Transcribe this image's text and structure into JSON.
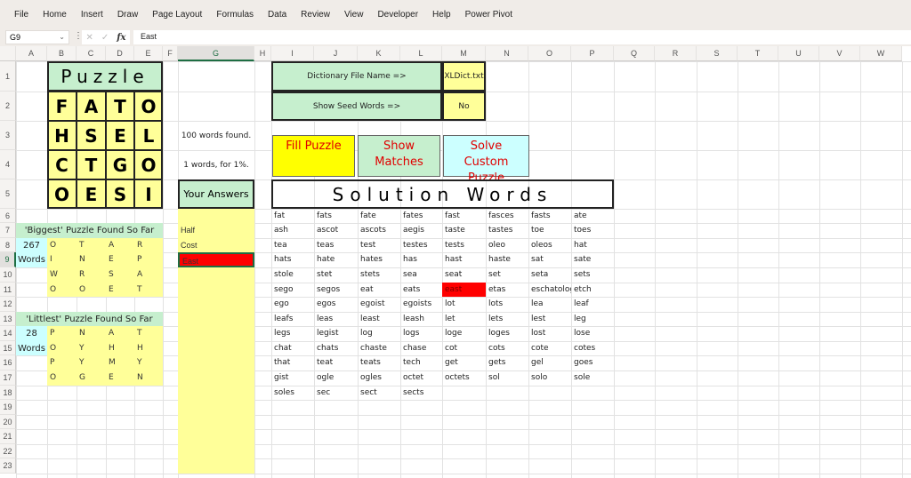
{
  "ribbon": {
    "tabs": [
      "File",
      "Home",
      "Insert",
      "Draw",
      "Page Layout",
      "Formulas",
      "Data",
      "Review",
      "View",
      "Developer",
      "Help",
      "Power Pivot"
    ]
  },
  "formula_bar": {
    "name_box": "G9",
    "cancel_icon": "✕",
    "enter_icon": "✓",
    "fx_label": "fx",
    "value": "East"
  },
  "columns": [
    "A",
    "B",
    "C",
    "D",
    "E",
    "F",
    "G",
    "H",
    "I",
    "J",
    "K",
    "L",
    "M",
    "N",
    "O",
    "P",
    "Q",
    "R",
    "S",
    "T",
    "U",
    "V",
    "W"
  ],
  "rows": [
    "1",
    "2",
    "3",
    "4",
    "5",
    "6",
    "7",
    "8",
    "9",
    "10",
    "11",
    "12",
    "13",
    "14",
    "15",
    "16",
    "17",
    "18",
    "19",
    "20",
    "21",
    "22",
    "23"
  ],
  "selected_cell": {
    "column": "G",
    "row": "9"
  },
  "puzzle": {
    "title": "Puzzle",
    "grid": [
      [
        "F",
        "A",
        "T",
        "O"
      ],
      [
        "H",
        "S",
        "E",
        "L"
      ],
      [
        "C",
        "T",
        "G",
        "O"
      ],
      [
        "O",
        "E",
        "S",
        "I"
      ]
    ]
  },
  "status": {
    "words_found": "100 words found.",
    "score": "1 words, for 1%."
  },
  "your_answers": {
    "header": "Your Answers",
    "answers": [
      "Half",
      "Cost",
      "East"
    ],
    "highlight_color": "#ff0000"
  },
  "settings": {
    "dictionary_label": "Dictionary File Name =>",
    "dictionary_value": "XLDict.txt",
    "seed_label": "Show Seed Words =>",
    "seed_value": "No"
  },
  "buttons": {
    "fill": "Fill Puzzle",
    "show": "Show Matches",
    "solve": "Solve Custom Puzzle"
  },
  "solution": {
    "title": "Solution Words",
    "highlight": "east",
    "columns": [
      [
        "fat",
        "ash",
        "tea",
        "hats",
        "stole",
        "sego",
        "ego",
        "leafs",
        "legs",
        "chat",
        "that",
        "gist",
        "soles"
      ],
      [
        "fats",
        "ascot",
        "teas",
        "hate",
        "stet",
        "segos",
        "egos",
        "leas",
        "legist",
        "chats",
        "teat",
        "ogle",
        "sec"
      ],
      [
        "fate",
        "ascots",
        "test",
        "hates",
        "stets",
        "eat",
        "egoist",
        "least",
        "log",
        "chaste",
        "teats",
        "ogles",
        "sect"
      ],
      [
        "fates",
        "aegis",
        "testes",
        "has",
        "sea",
        "eats",
        "egoists",
        "leash",
        "logs",
        "chase",
        "tech",
        "octet",
        "sects"
      ],
      [
        "fast",
        "taste",
        "tests",
        "hast",
        "seat",
        "east",
        "lot",
        "let",
        "loge",
        "cot",
        "get",
        "octets"
      ],
      [
        "fasces",
        "tastes",
        "oleo",
        "haste",
        "set",
        "etas",
        "lots",
        "lets",
        "loges",
        "cots",
        "gets",
        "sol"
      ],
      [
        "fasts",
        "toe",
        "oleos",
        "sat",
        "seta",
        "eschatolog",
        "lea",
        "lest",
        "lost",
        "cote",
        "gel",
        "solo"
      ],
      [
        "ate",
        "toes",
        "hat",
        "sate",
        "sets",
        "etch",
        "leaf",
        "leg",
        "lose",
        "cotes",
        "goes",
        "sole"
      ]
    ]
  },
  "biggest": {
    "title": "'Biggest' Puzzle Found So Far",
    "count": "267",
    "unit": "Words",
    "grid": [
      [
        "O",
        "T",
        "A",
        "R"
      ],
      [
        "I",
        "N",
        "E",
        "P"
      ],
      [
        "W",
        "R",
        "S",
        "A"
      ],
      [
        "O",
        "O",
        "E",
        "T"
      ]
    ]
  },
  "littlest": {
    "title": "'Littlest' Puzzle Found So Far",
    "count": "28",
    "unit": "Words",
    "grid": [
      [
        "P",
        "N",
        "A",
        "T"
      ],
      [
        "O",
        "Y",
        "H",
        "H"
      ],
      [
        "P",
        "Y",
        "M",
        "Y"
      ],
      [
        "O",
        "G",
        "E",
        "N"
      ]
    ]
  },
  "colors": {
    "green": "#c6efce",
    "yellow": "#ffff99",
    "cyan": "#ccffff",
    "bright_yellow": "#ffff00",
    "red": "#ff0000",
    "selection": "#1e6e43"
  }
}
